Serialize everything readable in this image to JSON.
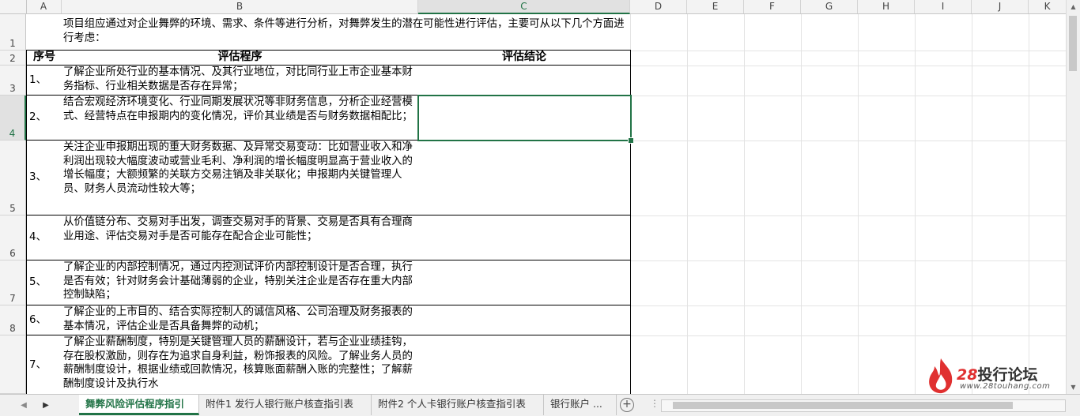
{
  "columns": [
    "A",
    "B",
    "C",
    "D",
    "E",
    "F",
    "G",
    "H",
    "I",
    "J",
    "K"
  ],
  "selected_column": "C",
  "rows": [
    "1",
    "2",
    "3",
    "4",
    "5",
    "6",
    "7",
    "8"
  ],
  "selected_row": "4",
  "intro": "项目组应通过对企业舞弊的环境、需求、条件等进行分析，对舞弊发生的潜在可能性进行评估，主要可从以下几个方面进行考虑：",
  "table": {
    "headers": {
      "index": "序号",
      "procedure": "评估程序",
      "conclusion": "评估结论"
    },
    "rows": [
      {
        "index": "1、",
        "procedure": "了解企业所处行业的基本情况、及其行业地位，对比同行业上市企业基本财务指标、行业相关数据是否存在异常；",
        "conclusion": ""
      },
      {
        "index": "2、",
        "procedure": "结合宏观经济环境变化、行业同期发展状况等非财务信息，分析企业经营模式、经营特点在申报期内的变化情况，评价其业绩是否与财务数据相配比；",
        "conclusion": ""
      },
      {
        "index": "3、",
        "procedure": "关注企业申报期出现的重大财务数据、及异常交易变动：比如营业收入和净利润出现较大幅度波动或营业毛利、净利润的增长幅度明显高于营业收入的增长幅度；大额频繁的关联方交易注销及非关联化；申报期内关键管理人员、财务人员流动性较大等；",
        "conclusion": ""
      },
      {
        "index": "4、",
        "procedure": "从价值链分布、交易对手出发，调查交易对手的背景、交易是否具有合理商业用途、评估交易对手是否可能存在配合企业可能性；",
        "conclusion": ""
      },
      {
        "index": "5、",
        "procedure": "了解企业的内部控制情况，通过内控测试评价内部控制设计是否合理，执行是否有效；针对财务会计基础薄弱的企业，特别关注企业是否存在重大内部控制缺陷；",
        "conclusion": ""
      },
      {
        "index": "6、",
        "procedure": "了解企业的上市目的、结合实际控制人的诚信风格、公司治理及财务报表的基本情况，评估企业是否具备舞弊的动机；",
        "conclusion": ""
      },
      {
        "index": "7、",
        "procedure": "了解企业薪酬制度，特别是关键管理人员的薪酬设计，若与企业业绩挂钩，存在股权激励，则存在为追求自身利益，粉饰报表的风险。了解业务人员的薪酬制度设计，根据业绩或回款情况，核算账面薪酬入账的完整性；了解薪酬制度设计及执行水",
        "conclusion": ""
      }
    ]
  },
  "sheet_tabs": [
    {
      "label": "舞弊风险评估程序指引",
      "active": true
    },
    {
      "label": "附件1 发行人银行账户核查指引表",
      "active": false
    },
    {
      "label": "附件2 个人卡银行账户核查指引表",
      "active": false
    },
    {
      "label": "银行账户 ...",
      "active": false
    }
  ],
  "add_sheet_label": "+",
  "watermark": {
    "brand": "投行论坛",
    "number": "28",
    "url": "www.28touhang.com"
  },
  "colors": {
    "accent": "#217346",
    "watermark_red": "#e03030"
  }
}
